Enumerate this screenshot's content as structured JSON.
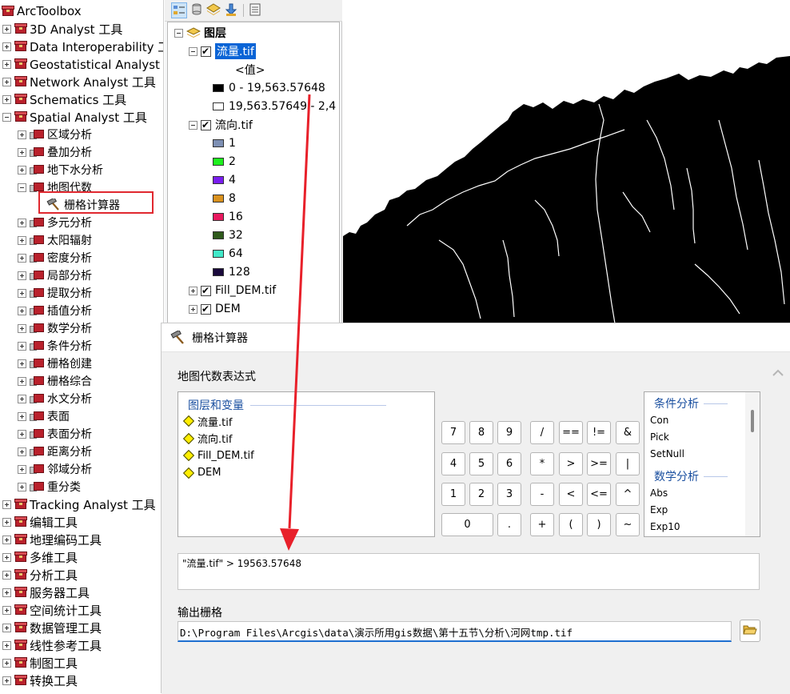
{
  "toolbox": {
    "title": "ArcToolbox",
    "items": [
      {
        "label": "3D Analyst 工具",
        "expanded": false
      },
      {
        "label": "Data Interoperability 工具",
        "expanded": false
      },
      {
        "label": "Geostatistical Analyst 工具",
        "expanded": false
      },
      {
        "label": "Network Analyst 工具",
        "expanded": false
      },
      {
        "label": "Schematics 工具",
        "expanded": false
      },
      {
        "label": "Spatial Analyst 工具",
        "expanded": true
      }
    ],
    "spatial_children": [
      "区域分析",
      "叠加分析",
      "地下水分析",
      "地图代数",
      "栅格计算器",
      "多元分析",
      "太阳辐射",
      "密度分析",
      "局部分析",
      "提取分析",
      "插值分析",
      "数学分析",
      "条件分析",
      "栅格创建",
      "栅格综合",
      "水文分析",
      "表面",
      "表面分析",
      "距离分析",
      "邻域分析",
      "重分类"
    ],
    "bottom_items": [
      "Tracking Analyst 工具",
      "编辑工具",
      "地理编码工具",
      "多维工具",
      "分析工具",
      "服务器工具",
      "空间统计工具",
      "数据管理工具",
      "线性参考工具",
      "制图工具",
      "转换工具"
    ]
  },
  "toc": {
    "root_label": "图层",
    "layers": [
      {
        "name": "流量.tif",
        "checked": true,
        "selected": true,
        "value_header": "<值>",
        "classes": [
          {
            "label": "0 - 19,563.57648",
            "color": "#000000"
          },
          {
            "label": "19,563.57649 - 2,4",
            "color": "#ffffff"
          }
        ]
      },
      {
        "name": "流向.tif",
        "checked": true,
        "classes": [
          {
            "label": "1",
            "color": "#7d8fb3"
          },
          {
            "label": "2",
            "color": "#1ef01e"
          },
          {
            "label": "4",
            "color": "#7a1ef0"
          },
          {
            "label": "8",
            "color": "#d9911e"
          },
          {
            "label": "16",
            "color": "#e8195f"
          },
          {
            "label": "32",
            "color": "#2f5a1c"
          },
          {
            "label": "64",
            "color": "#40e8c8"
          },
          {
            "label": "128",
            "color": "#1a0a3c"
          }
        ]
      },
      {
        "name": "Fill_DEM.tif",
        "checked": true
      },
      {
        "name": "DEM",
        "checked": true
      }
    ]
  },
  "dialog": {
    "title": "栅格计算器",
    "expr_section_label": "地图代数表达式",
    "vars_header": "图层和变量",
    "vars": [
      "流量.tif",
      "流向.tif",
      "Fill_DEM.tif",
      "DEM"
    ],
    "buttons": [
      [
        "7",
        "8",
        "9",
        "/",
        "==",
        "!=",
        "&"
      ],
      [
        "4",
        "5",
        "6",
        "*",
        ">",
        ">=",
        "|"
      ],
      [
        "1",
        "2",
        "3",
        "-",
        "<",
        "<=",
        "^"
      ],
      [
        "0",
        ".",
        "+",
        "(",
        ")",
        "~"
      ]
    ],
    "func_groups": [
      {
        "header": "条件分析",
        "items": [
          "Con",
          "Pick",
          "SetNull"
        ]
      },
      {
        "header": "数学分析",
        "items": [
          "Abs",
          "Exp",
          "Exp10"
        ]
      }
    ],
    "expression": "\"流量.tif\" > 19563.57648",
    "output_label": "输出栅格",
    "output_path": "D:\\Program Files\\Arcgis\\data\\演示所用gis数据\\第十五节\\分析\\河网tmp.tif"
  },
  "colors": {
    "highlight_box": "#e0282f",
    "arrow": "#e8202a",
    "selection": "#0a64d6",
    "group_header": "#1b50a0"
  }
}
